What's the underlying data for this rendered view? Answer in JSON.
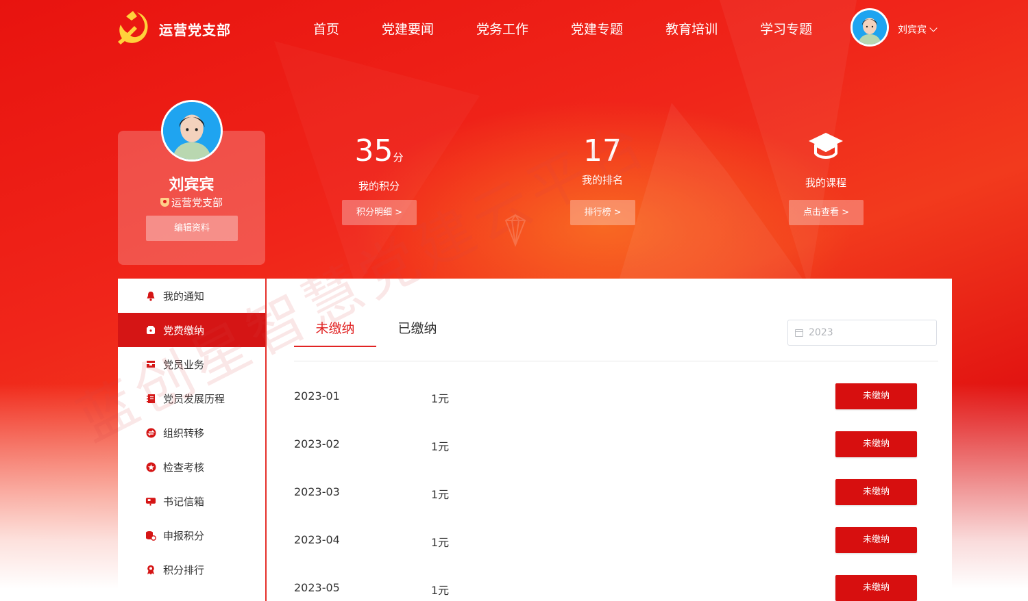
{
  "header": {
    "brand": "运营党支部",
    "nav": [
      "首页",
      "党建要闻",
      "党务工作",
      "党建专题",
      "教育培训",
      "学习专题"
    ],
    "user_name": "刘宾宾"
  },
  "profile": {
    "name": "刘宾宾",
    "branch": "运营党支部",
    "edit_label": "编辑资料"
  },
  "stats": {
    "points_value": "35",
    "points_unit": "分",
    "points_label": "我的积分",
    "points_button": "积分明细 >",
    "rank_value": "17",
    "rank_label": "我的排名",
    "rank_button": "排行榜 >",
    "course_label": "我的课程",
    "course_button": "点击查看 >"
  },
  "sidebar": {
    "items": [
      {
        "label": "我的通知",
        "icon": "bell-icon"
      },
      {
        "label": "党费缴纳",
        "icon": "wallet-icon"
      },
      {
        "label": "党员业务",
        "icon": "tray-icon"
      },
      {
        "label": "党员发展历程",
        "icon": "notebook-icon"
      },
      {
        "label": "组织转移",
        "icon": "transfer-icon"
      },
      {
        "label": "检查考核",
        "icon": "star-icon"
      },
      {
        "label": "书记信箱",
        "icon": "mailbox-icon"
      },
      {
        "label": "申报积分",
        "icon": "coins-icon"
      },
      {
        "label": "积分排行",
        "icon": "ribbon-icon"
      }
    ],
    "active_index": 1
  },
  "dues": {
    "tabs": [
      "未缴纳",
      "已缴纳"
    ],
    "active_tab": 0,
    "year": "2023",
    "rows": [
      {
        "period": "2023-01",
        "amount": "1元",
        "status": "未缴纳"
      },
      {
        "period": "2023-02",
        "amount": "1元",
        "status": "未缴纳"
      },
      {
        "period": "2023-03",
        "amount": "1元",
        "status": "未缴纳"
      },
      {
        "period": "2023-04",
        "amount": "1元",
        "status": "未缴纳"
      },
      {
        "period": "2023-05",
        "amount": "1元",
        "status": "未缴纳"
      }
    ]
  },
  "watermark": "蓝创星智慧党建云平台",
  "colors": {
    "primary": "#d51515",
    "accent": "#e12323"
  }
}
